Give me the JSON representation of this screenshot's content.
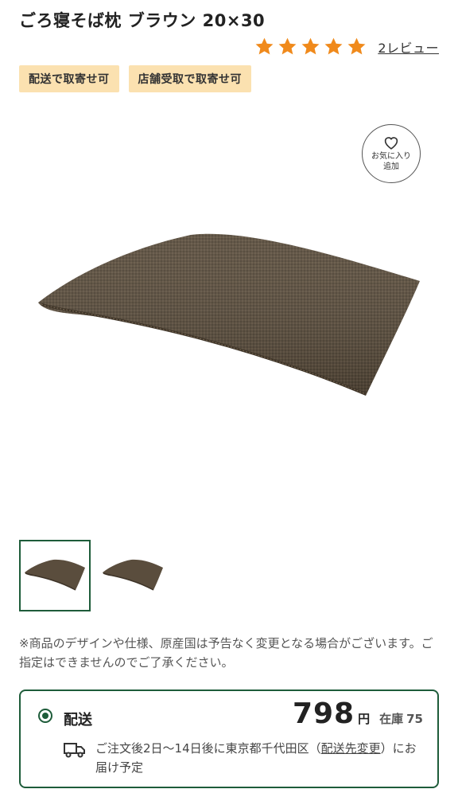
{
  "product": {
    "title": "ごろ寝そば枕 ブラウン 20×30",
    "rating_stars": 5,
    "review_link": "2レビュー",
    "tags": [
      "配送で取寄せ可",
      "店舗受取で取寄せ可"
    ],
    "favorite_line1": "お気に入り",
    "favorite_line2": "追加",
    "image_alt": "star-icon",
    "notice": "※商品のデザインや仕様、原産国は予告なく変更となる場合がございます。ご指定はできませんのでご了承ください。"
  },
  "delivery": {
    "label": "配送",
    "price": "798",
    "currency": "円",
    "stock_label": "在庫",
    "stock_count": "75",
    "info_prefix": "ご注文後2日〜14日後に東京都千代田区（",
    "info_link": "配送先変更",
    "info_suffix": "）にお届け予定"
  },
  "colors": {
    "star": "#f08a1c",
    "tag_bg": "#fbe1b0",
    "accent_green": "#1e5c3a",
    "pillow": "#5a4d3d"
  }
}
